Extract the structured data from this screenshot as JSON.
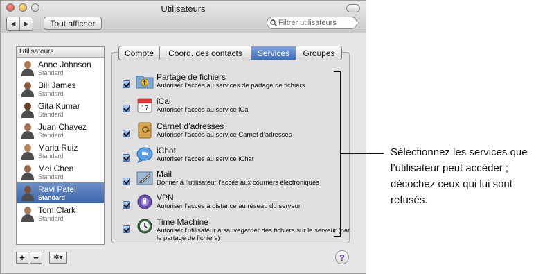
{
  "window": {
    "title": "Utilisateurs"
  },
  "toolbar": {
    "show_all_label": "Tout afficher",
    "nav_back": "◀",
    "nav_forward": "▶"
  },
  "search": {
    "placeholder": "Filtrer utilisateurs"
  },
  "users_panel": {
    "header": "Utilisateurs",
    "users": [
      {
        "name": "Anne Johnson",
        "role": "Standard"
      },
      {
        "name": "Bill James",
        "role": "Standard"
      },
      {
        "name": "Gita Kumar",
        "role": "Standard"
      },
      {
        "name": "Juan Chavez",
        "role": "Standard"
      },
      {
        "name": "Maria Ruiz",
        "role": "Standard"
      },
      {
        "name": "Mei Chen",
        "role": "Standard"
      },
      {
        "name": "Ravi Patel",
        "role": "Standard",
        "selected": true
      },
      {
        "name": "Tom Clark",
        "role": "Standard"
      }
    ]
  },
  "bottom_bar": {
    "add_label": "+",
    "remove_label": "−",
    "action_label": "✲▾",
    "help_label": "?"
  },
  "tabs": [
    {
      "label": "Compte"
    },
    {
      "label": "Coord. des contacts"
    },
    {
      "label": "Services",
      "active": true
    },
    {
      "label": "Groupes"
    }
  ],
  "services": [
    {
      "title": "Partage de fichiers",
      "desc": "Autoriser l’accès au services de partage de fichiers",
      "checked": true,
      "icon": "file-sharing-icon"
    },
    {
      "title": "iCal",
      "desc": "Autoriser l’accès au service iCal",
      "checked": true,
      "icon": "ical-icon",
      "icon_text": "17"
    },
    {
      "title": "Carnet d’adresses",
      "desc": "Autoriser l’accès au service Carnet d’adresses",
      "checked": true,
      "icon": "address-book-icon"
    },
    {
      "title": "iChat",
      "desc": "Autoriser l’accès au service iChat",
      "checked": true,
      "icon": "ichat-icon"
    },
    {
      "title": "Mail",
      "desc": "Donner à l’utilisateur l’accès aux courriers électroniques",
      "checked": true,
      "icon": "mail-icon"
    },
    {
      "title": "VPN",
      "desc": "Autoriser l’accès à distance au réseau du serveur",
      "checked": true,
      "icon": "vpn-icon"
    },
    {
      "title": "Time Machine",
      "desc": "Autoriser l’utilisateur à sauvegarder des fichiers sur le serveur (par le partage de fichiers)",
      "checked": true,
      "icon": "time-machine-icon"
    }
  ],
  "callout": {
    "text": "Sélectionnez les services que l’utilisateur peut accéder ; décochez ceux qui lui sont refusés."
  },
  "colors": {
    "accent": "#3d6fc0",
    "selection": "#4a70b4"
  }
}
